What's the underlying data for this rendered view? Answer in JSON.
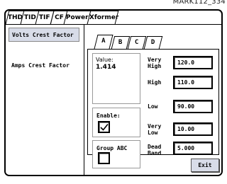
{
  "caption": "MARK112_334",
  "top_tabs": [
    "THD",
    "TID",
    "TIF",
    "CF",
    "Power",
    "Xformer"
  ],
  "left_panel": {
    "items": [
      "Volts Crest Factor",
      "Amps Crest Factor"
    ]
  },
  "sub_tabs": [
    "A",
    "B",
    "C",
    "D"
  ],
  "value_box": {
    "label": "Value:",
    "value": "1.414"
  },
  "enable": {
    "label": "Enable:",
    "checked": true
  },
  "group": {
    "label": "Group ABC",
    "checked": false
  },
  "thresholds": [
    {
      "label_line1": "Very",
      "label_line2": "High",
      "value": "120.0"
    },
    {
      "label_line1": "High",
      "label_line2": "",
      "value": "110.0"
    },
    {
      "label_line1": "Low",
      "label_line2": "",
      "value": "90.00"
    },
    {
      "label_line1": "Very",
      "label_line2": "Low",
      "value": "10.00"
    },
    {
      "label_line1": "Dead",
      "label_line2": "Band",
      "value": "5.000"
    }
  ],
  "exit_label": "Exit"
}
